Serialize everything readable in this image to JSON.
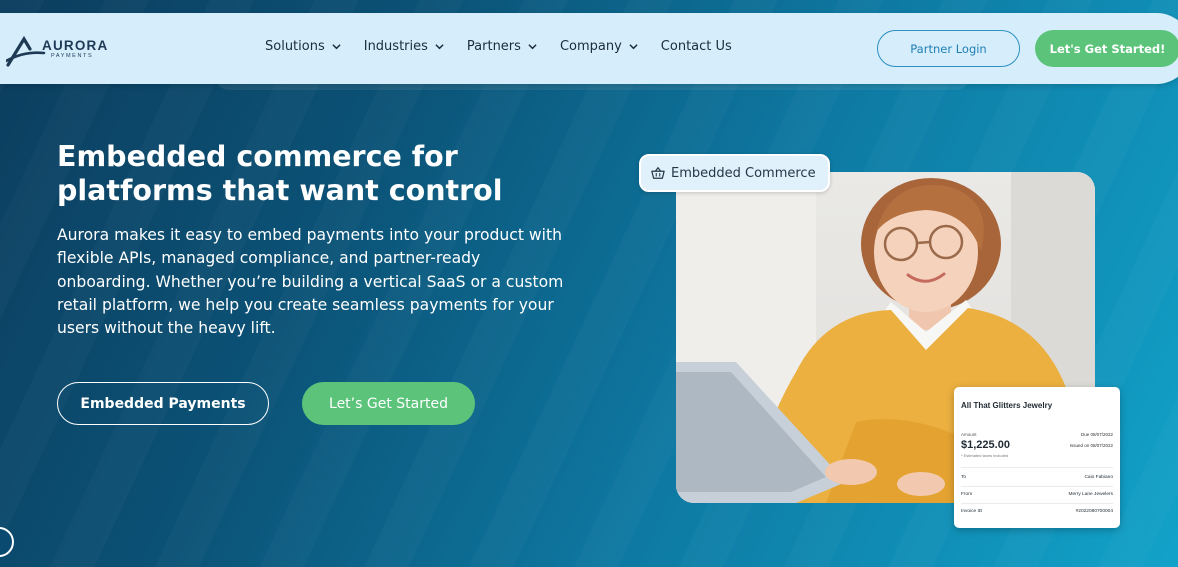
{
  "brand": {
    "name": "AURORA",
    "subtitle": "PAYMENTS"
  },
  "nav": {
    "items": [
      {
        "label": "Solutions",
        "dropdown": true
      },
      {
        "label": "Industries",
        "dropdown": true
      },
      {
        "label": "Partners",
        "dropdown": true
      },
      {
        "label": "Company",
        "dropdown": true
      },
      {
        "label": "Contact Us",
        "dropdown": false
      }
    ],
    "login_label": "Partner Login",
    "cta_label": "Let's Get Started!"
  },
  "hero": {
    "title": "Embedded commerce for platforms that want control",
    "body": "Aurora makes it easy to embed payments into your product with flexible APIs, managed compliance, and partner-ready onboarding. Whether you’re building a vertical SaaS or a custom retail platform, we help you create seamless payments for your users without the heavy lift.",
    "secondary_button": "Embedded Payments",
    "primary_button": "Let’s Get Started"
  },
  "tag": {
    "label": "Embedded Commerce",
    "icon": "basket-icon"
  },
  "invoice": {
    "merchant": "All That Glitters Jewelry",
    "amount_label": "Amount",
    "amount": "$1,225.00",
    "taxes_note": "* Estimated taxes included",
    "due": "Due 08/07/2022",
    "issued": "Issued on 08/07/2022",
    "rows": [
      {
        "label": "To",
        "value": "Caio Fabiano"
      },
      {
        "label": "From",
        "value": "Merry Lane Jewelers"
      },
      {
        "label": "Invoice ID",
        "value": "#2022080700004"
      }
    ]
  },
  "colors": {
    "accent_green": "#5cc47a",
    "nav_bg": "#d6eefb",
    "link_blue": "#1f7fb5"
  }
}
